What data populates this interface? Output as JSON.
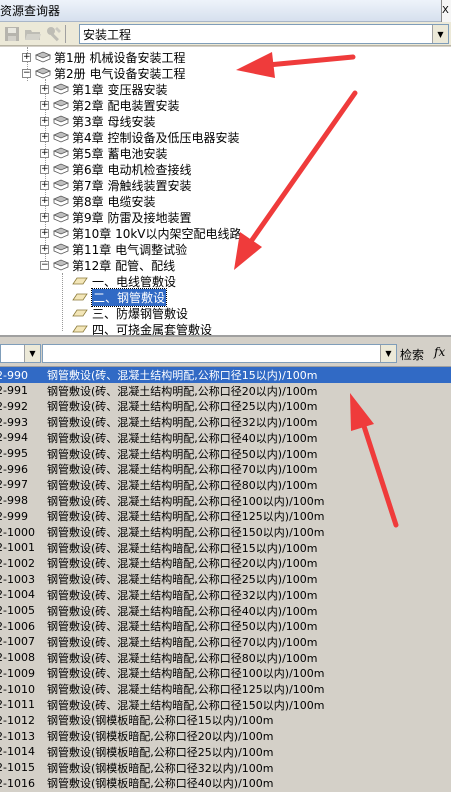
{
  "window": {
    "title": "资源查询器",
    "close_glyph": "X"
  },
  "toolbar": {
    "icons": [
      "save-icon",
      "open-folder-icon",
      "tools-icon"
    ],
    "combo_value": "安装工程"
  },
  "tree": {
    "volume1": "第1册  机械设备安装工程",
    "volume2": "第2册  电气设备安装工程",
    "chapters": [
      "第1章   变压器安装",
      "第2章   配电装置安装",
      "第3章   母线安装",
      "第4章   控制设备及低压电器安装",
      "第5章   蓄电池安装",
      "第6章   电动机检查接线",
      "第7章   滑触线装置安装",
      "第8章   电缆安装",
      "第9章   防雷及接地装置",
      "第10章   10kV以内架空配电线路",
      "第11章   电气调整试验",
      "第12章   配管、配线"
    ],
    "sections": [
      "一、电线管敷设",
      "二、钢管敷设",
      "三、防爆钢管敷设",
      "四、可挠金属套管敷设"
    ],
    "selected_section": 1
  },
  "search": {
    "label": "检索",
    "fx": "fx"
  },
  "list": {
    "rows": [
      [
        "2-990",
        "钢管敷设(砖、混凝土结构明配,公称口径15以内)/100m"
      ],
      [
        "2-991",
        "钢管敷设(砖、混凝土结构明配,公称口径20以内)/100m"
      ],
      [
        "2-992",
        "钢管敷设(砖、混凝土结构明配,公称口径25以内)/100m"
      ],
      [
        "2-993",
        "钢管敷设(砖、混凝土结构明配,公称口径32以内)/100m"
      ],
      [
        "2-994",
        "钢管敷设(砖、混凝土结构明配,公称口径40以内)/100m"
      ],
      [
        "2-995",
        "钢管敷设(砖、混凝土结构明配,公称口径50以内)/100m"
      ],
      [
        "2-996",
        "钢管敷设(砖、混凝土结构明配,公称口径70以内)/100m"
      ],
      [
        "2-997",
        "钢管敷设(砖、混凝土结构明配,公称口径80以内)/100m"
      ],
      [
        "2-998",
        "钢管敷设(砖、混凝土结构明配,公称口径100以内)/100m"
      ],
      [
        "2-999",
        "钢管敷设(砖、混凝土结构明配,公称口径125以内)/100m"
      ],
      [
        "2-1000",
        "钢管敷设(砖、混凝土结构明配,公称口径150以内)/100m"
      ],
      [
        "2-1001",
        "钢管敷设(砖、混凝土结构暗配,公称口径15以内)/100m"
      ],
      [
        "2-1002",
        "钢管敷设(砖、混凝土结构暗配,公称口径20以内)/100m"
      ],
      [
        "2-1003",
        "钢管敷设(砖、混凝土结构暗配,公称口径25以内)/100m"
      ],
      [
        "2-1004",
        "钢管敷设(砖、混凝土结构暗配,公称口径32以内)/100m"
      ],
      [
        "2-1005",
        "钢管敷设(砖、混凝土结构暗配,公称口径40以内)/100m"
      ],
      [
        "2-1006",
        "钢管敷设(砖、混凝土结构暗配,公称口径50以内)/100m"
      ],
      [
        "2-1007",
        "钢管敷设(砖、混凝土结构暗配,公称口径70以内)/100m"
      ],
      [
        "2-1008",
        "钢管敷设(砖、混凝土结构暗配,公称口径80以内)/100m"
      ],
      [
        "2-1009",
        "钢管敷设(砖、混凝土结构暗配,公称口径100以内)/100m"
      ],
      [
        "2-1010",
        "钢管敷设(砖、混凝土结构暗配,公称口径125以内)/100m"
      ],
      [
        "2-1011",
        "钢管敷设(砖、混凝土结构暗配,公称口径150以内)/100m"
      ],
      [
        "2-1012",
        "钢管敷设(钢模板暗配,公称口径15以内)/100m"
      ],
      [
        "2-1013",
        "钢管敷设(钢模板暗配,公称口径20以内)/100m"
      ],
      [
        "2-1014",
        "钢管敷设(钢模板暗配,公称口径25以内)/100m"
      ],
      [
        "2-1015",
        "钢管敷设(钢模板暗配,公称口径32以内)/100m"
      ],
      [
        "2-1016",
        "钢管敷设(钢模板暗配,公称口径40以内)/100m"
      ]
    ],
    "selected_row": 0
  },
  "colors": {
    "selection": "#316ac5",
    "arrow": "#ef3b3b",
    "panel": "#d4d0c8"
  }
}
